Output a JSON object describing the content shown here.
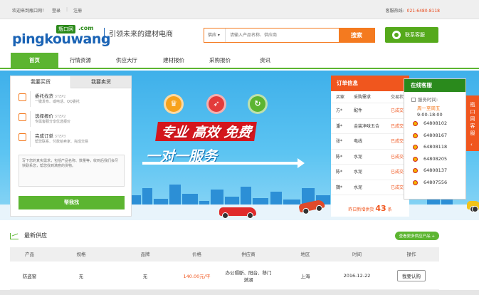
{
  "topbar": {
    "welcome": "欢迎来到瓶口网！",
    "login": "登录",
    "register": "注册",
    "hotline_label": "客服热线:",
    "hotline": "021-6480-8118"
  },
  "header": {
    "logo_text": "pingkouwang",
    "logo_badge": "瓶口网",
    "logo_com": ".com",
    "slogan": "引领未来的建材电商",
    "search_scope": "供应",
    "search_placeholder": "请输入产品名称、供应商",
    "search_button": "搜索",
    "service_button": "联系客服"
  },
  "nav": [
    "首页",
    "行情资源",
    "供应大厅",
    "建材报价",
    "采购报价",
    "资讯"
  ],
  "banner": {
    "slogan_1": "专业 高效 免费",
    "slogan_2": "一对一服务"
  },
  "trade_panel": {
    "tabs": [
      "我要买货",
      "我要卖货"
    ],
    "steps": [
      {
        "title": "委托找货",
        "step": "STEP1",
        "desc": "一键发布、或电话、QQ委托"
      },
      {
        "title": "选择报价",
        "step": "STEP2",
        "desc": "专属客服分享优选报价"
      },
      {
        "title": "完成订单",
        "step": "STEP3",
        "desc": "帮您联系、付款给卖家、完成交易"
      }
    ],
    "textarea_placeholder": "写下您的真实需求，包括产品名称、数量等，收到后我们会尽快联系您，帮您找到满意的货物。",
    "help_button": "帮我找"
  },
  "orders": {
    "title": "订单信息",
    "columns": [
      "买家",
      "采购需求",
      "交易状态"
    ],
    "rows": [
      {
        "buyer": "方*",
        "need": "配件",
        "status": "已成交"
      },
      {
        "buyer": "潘*",
        "need": "金装净味五合",
        "status": "已成交"
      },
      {
        "buyer": "张*",
        "need": "电线",
        "status": "已成交"
      },
      {
        "buyer": "陈*",
        "need": "水泥",
        "status": "已成交"
      },
      {
        "buyer": "陈*",
        "need": "水泥",
        "status": "已成交"
      },
      {
        "buyer": "魏*",
        "need": "水泥",
        "status": "已成交"
      }
    ],
    "footer_prefix": "昨日新增供货",
    "footer_count": "43",
    "footer_suffix": "条"
  },
  "online_service": {
    "title": "在线客服",
    "time_label": "服务时间:",
    "days": "周一至周五",
    "hours": "9:00-18:00",
    "qq_numbers": [
      "64808102",
      "64808167",
      "64808118",
      "64808205",
      "64808137",
      "64807556"
    ]
  },
  "side_tab": {
    "label": "瓶口网客服",
    "arrow": "‹"
  },
  "supply": {
    "title": "最新供应",
    "more_button": "查看更多供应产品",
    "columns": [
      "产品",
      "规格",
      "品牌",
      "价格",
      "供应商",
      "地区",
      "时间",
      "操作"
    ],
    "rows": [
      {
        "product": "防盗窗",
        "spec": "无",
        "brand": "无",
        "price": "140.00元/平",
        "supplier": "办公隔断、阳台、移门满湖",
        "region": "上海",
        "date": "2016-12-22",
        "action": "我要认购"
      }
    ]
  }
}
